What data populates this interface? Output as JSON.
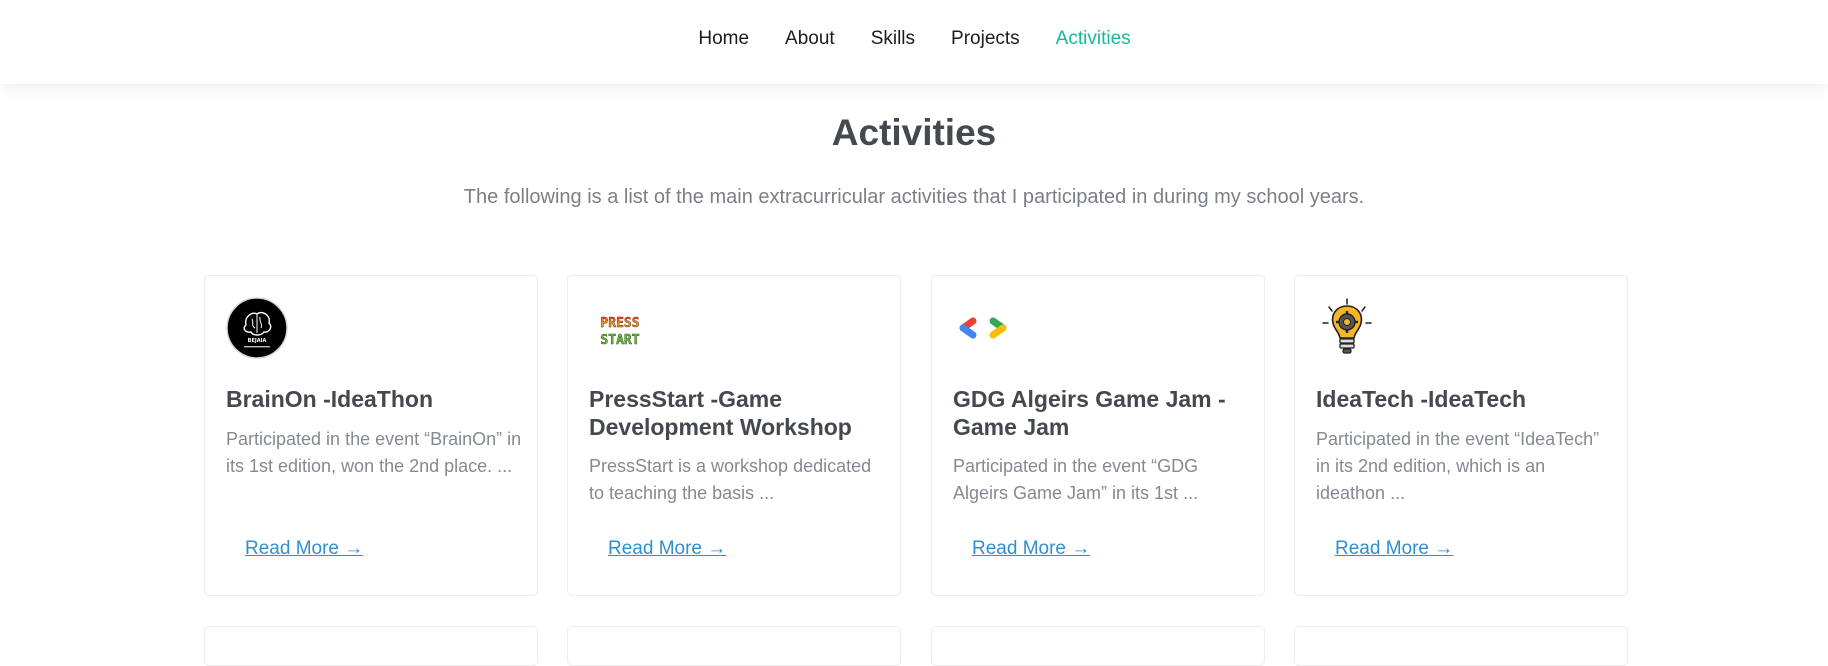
{
  "nav": {
    "links": [
      "Home",
      "About",
      "Skills",
      "Projects",
      "Activities"
    ],
    "active": "Activities",
    "accent_color": "#14b89c"
  },
  "section": {
    "title": "Activities",
    "subtitle": "The following is a list of the main extracurricular activities that I participated in during my school years."
  },
  "cards": [
    {
      "icon": "brain-logo-icon",
      "logo_text": "BEJAIA",
      "title": "BrainOn -IdeaThon",
      "description": "Participated in the event “BrainOn” in its 1st edition, won the 2nd place. ...",
      "link": "Read More →"
    },
    {
      "icon": "press-start-logo-icon",
      "logo_text": "PRESS START",
      "title": "PressStart -Game Development Workshop",
      "description": "PressStart is a workshop dedicated to teaching the basis ...",
      "link": "Read More →"
    },
    {
      "icon": "gdg-logo-icon",
      "title": "GDG Algeirs Game Jam -Game Jam",
      "description": "Participated in the event “GDG Algeirs Game Jam” in its 1st ...",
      "link": "Read More →"
    },
    {
      "icon": "lightbulb-gear-icon",
      "title": "IdeaTech -IdeaTech",
      "description": "Participated in the event “IdeaTech” in its 2nd edition, which is an ideathon ...",
      "link": "Read More →"
    }
  ],
  "colors": {
    "link": "#2f8fd0",
    "title": "#444950",
    "muted_text": "#858991"
  }
}
